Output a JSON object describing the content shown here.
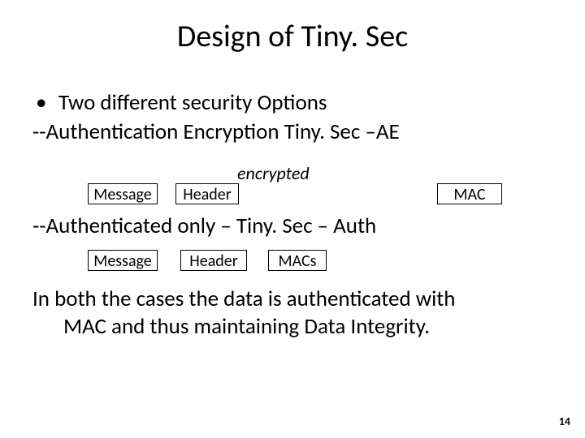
{
  "title": "Design of Tiny. Sec",
  "bullet1": "Two different security Options",
  "line_ae": "--Authentication Encryption Tiny. Sec –AE",
  "encrypted_label": "encrypted",
  "row1": {
    "message": "Message",
    "header": "Header",
    "mac": "MAC"
  },
  "line_auth": "--Authenticated only – Tiny. Sec – Auth",
  "row2": {
    "message": "Message",
    "header": "Header",
    "macs": "MACs"
  },
  "closing_l1": "In both the cases the data is authenticated with",
  "closing_l2": "MAC and thus maintaining Data Integrity.",
  "page_number": "14"
}
